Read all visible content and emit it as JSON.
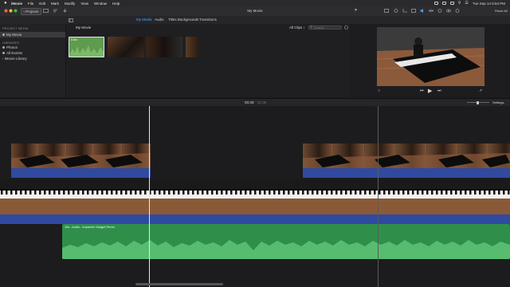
{
  "menubar": {
    "items": [
      "iMovie",
      "File",
      "Edit",
      "Mark",
      "Modify",
      "View",
      "Window",
      "Help"
    ],
    "clock": "Tue Sep 14  5:54 PM"
  },
  "toolbar": {
    "projects_label": "Projects",
    "window_title": "My Movie",
    "reset_all_label": "Reset All"
  },
  "browser": {
    "tabs": [
      "My Media",
      "Audio",
      "Titles",
      "Backgrounds",
      "Transitions"
    ],
    "active_tab": "My Media",
    "event_title": "My Movie",
    "filter_label": "All Clips",
    "search_placeholder": "Search",
    "thumb_badge": "5.6m"
  },
  "library": {
    "project_media_heading": "PROJECT MEDIA",
    "project_item": "My Movie",
    "libraries_heading": "LIBRARIES",
    "items": [
      "Photos",
      "All Events",
      "iMovie Library"
    ]
  },
  "timeline": {
    "timecode_current": "00:30",
    "timecode_total": "01:35",
    "settings_label": "Settings",
    "music_label": "10s - Audio - Impactful Gadget Remix"
  },
  "colors": {
    "accent": "#4aa3ff",
    "audio_blue": "#2f4aa0",
    "music_green": "#2f8f4a"
  }
}
